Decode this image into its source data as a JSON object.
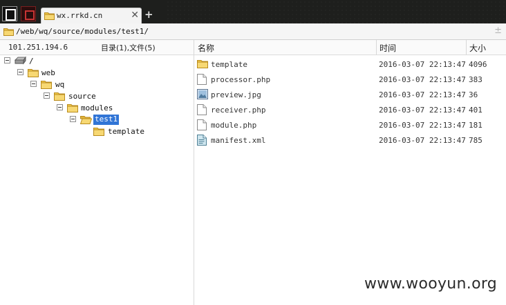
{
  "tab": {
    "title": "wx.rrkd.cn",
    "close": "✕",
    "new_tab": "+"
  },
  "address": {
    "path": "/web/wq/source/modules/test1/",
    "toggle": "±"
  },
  "left": {
    "ip": "101.251.194.6",
    "summary": "目录(1),文件(5)",
    "tree": [
      {
        "label": "/",
        "icon": "drive-icon"
      },
      {
        "label": "web",
        "icon": "folder-icon"
      },
      {
        "label": "wq",
        "icon": "folder-icon"
      },
      {
        "label": "source",
        "icon": "folder-icon"
      },
      {
        "label": "modules",
        "icon": "folder-icon"
      },
      {
        "label": "test1",
        "icon": "folder-open-icon",
        "selected": true
      },
      {
        "label": "template",
        "icon": "folder-icon"
      }
    ]
  },
  "table": {
    "headers": {
      "name": "名称",
      "time": "时间",
      "size": "大小"
    },
    "rows": [
      {
        "name": "template",
        "time": "2016-03-07 22:13:47",
        "size": "4096",
        "icon": "folder-icon"
      },
      {
        "name": "processor.php",
        "time": "2016-03-07 22:13:47",
        "size": "383",
        "icon": "file-icon"
      },
      {
        "name": "preview.jpg",
        "time": "2016-03-07 22:13:47",
        "size": "36",
        "icon": "image-file-icon"
      },
      {
        "name": "receiver.php",
        "time": "2016-03-07 22:13:47",
        "size": "401",
        "icon": "file-icon"
      },
      {
        "name": "module.php",
        "time": "2016-03-07 22:13:47",
        "size": "181",
        "icon": "file-icon"
      },
      {
        "name": "manifest.xml",
        "time": "2016-03-07 22:13:47",
        "size": "785",
        "icon": "xml-file-icon"
      }
    ]
  },
  "watermark": "www.wooyun.org",
  "colors": {
    "selection": "#3175d6",
    "folder": "#f2c94c",
    "titlebar": "#1e1f1d"
  }
}
